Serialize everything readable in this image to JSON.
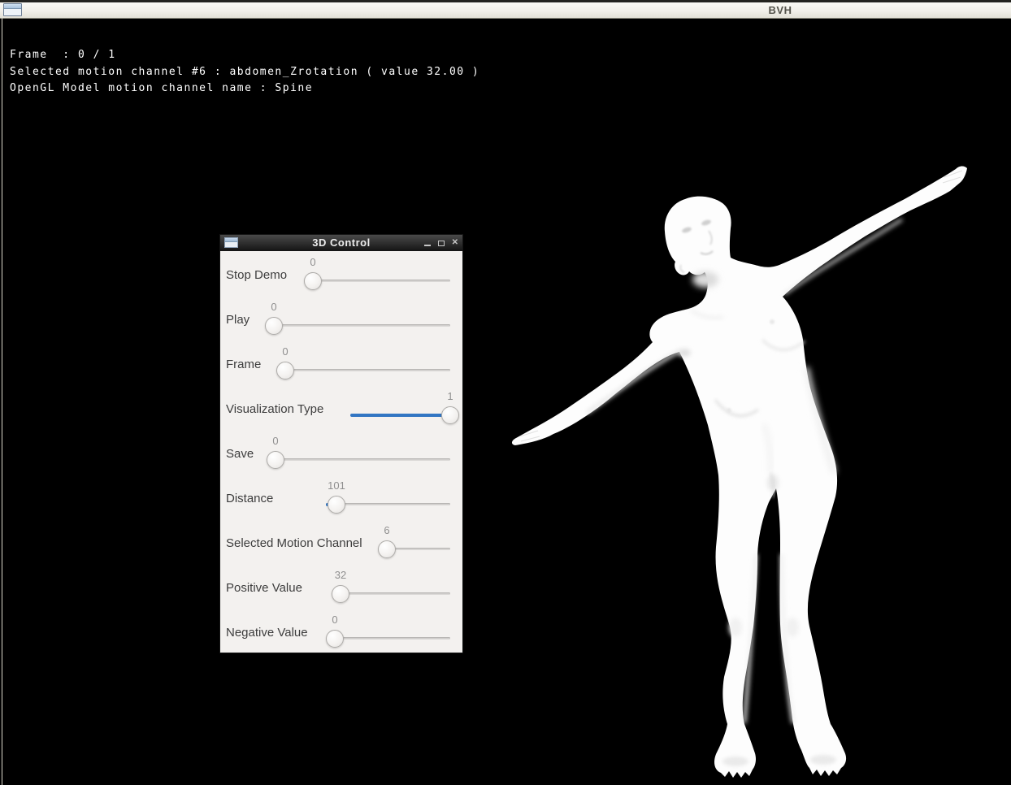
{
  "window": {
    "title": "BVH"
  },
  "hud": {
    "lines": [
      "Frame  : 0 / 1",
      "Selected motion channel #6 : abdomen_Zrotation ( value 32.00 )",
      "OpenGL Model motion channel name : Spine"
    ]
  },
  "control_panel": {
    "title": "3D Control",
    "window_buttons": {
      "close_glyph": "✕"
    },
    "sliders": [
      {
        "label": "Stop Demo",
        "value": "0"
      },
      {
        "label": "Play",
        "value": "0"
      },
      {
        "label": "Frame",
        "value": "0"
      },
      {
        "label": "Visualization Type",
        "value": "1"
      },
      {
        "label": "Save",
        "value": "0"
      },
      {
        "label": "Distance",
        "value": "101"
      },
      {
        "label": "Selected Motion Channel",
        "value": "6"
      },
      {
        "label": "Positive Value",
        "value": "32"
      },
      {
        "label": "Negative Value",
        "value": "0"
      }
    ]
  },
  "scene": {
    "model": "white female mannequin, arms outstretched, right arm raised, leaning",
    "model_color": "#ffffff",
    "background_color": "#000000"
  },
  "colors": {
    "accent_blue": "#3276c3",
    "panel_background": "#f3f1ef",
    "panel_titlebar_dark": "#2c2c2c",
    "main_titlebar_light": "#f1efe9",
    "hud_text": "#ffffff"
  }
}
